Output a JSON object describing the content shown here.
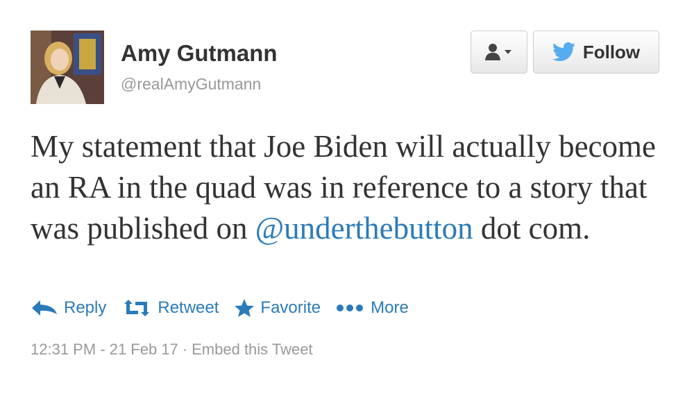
{
  "user": {
    "display_name": "Amy Gutmann",
    "handle": "@realAmyGutmann"
  },
  "header_buttons": {
    "follow_label": "Follow"
  },
  "tweet": {
    "text_before": "My statement that Joe Biden will actually become an RA in the quad was in reference to a story that was published on ",
    "mention": "@underthebutton",
    "text_after": " dot com."
  },
  "actions": {
    "reply": "Reply",
    "retweet": "Retweet",
    "favorite": "Favorite",
    "more": "More"
  },
  "meta": {
    "timestamp": "12:31 PM - 21 Feb 17",
    "separator": "·",
    "embed": "Embed this Tweet"
  },
  "colors": {
    "link": "#2b7bb9",
    "text": "#333333",
    "muted": "#999999",
    "twitter_bird": "#55acee"
  },
  "icons": {
    "avatar": "profile-photo",
    "user_dropdown": "user-icon",
    "follow": "twitter-bird-icon",
    "reply": "reply-arrow-icon",
    "retweet": "retweet-icon",
    "favorite": "star-icon",
    "more": "dots-icon"
  }
}
